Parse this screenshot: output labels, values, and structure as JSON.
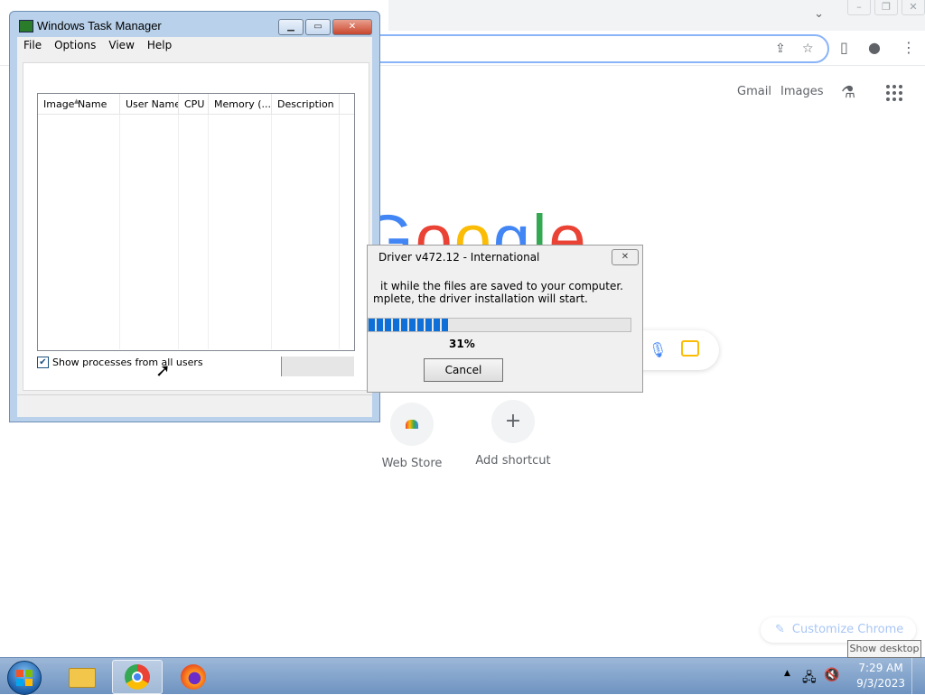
{
  "browser": {
    "window_buttons": [
      "–",
      "❐",
      "✕"
    ],
    "top_links": {
      "gmail": "Gmail",
      "images": "Images"
    },
    "logo_letters": [
      "G",
      "o",
      "o",
      "g",
      "l",
      "e"
    ],
    "shortcuts": [
      {
        "label": "Web Store",
        "icon": "webstore-icon"
      },
      {
        "label": "Add shortcut",
        "icon": "+"
      }
    ],
    "customize_label": "Customize Chrome",
    "show_desktop_tooltip": "Show desktop"
  },
  "task_manager": {
    "title": "Windows Task Manager",
    "menu": [
      "File",
      "Options",
      "View",
      "Help"
    ],
    "columns": [
      "Image Name",
      "User Name",
      "CPU",
      "Memory (...",
      "Description"
    ],
    "show_all_users_label": "Show processes from all users",
    "show_all_users_checked": true
  },
  "driver_dialog": {
    "title": "Driver v472.12 - International",
    "message_line1": "it while the files are saved to your computer.",
    "message_line2": "mplete, the driver installation will start.",
    "progress_percent": 31,
    "progress_label": "31%",
    "cancel_label": "Cancel"
  },
  "taskbar": {
    "apps": [
      "explorer-icon",
      "chrome-icon",
      "firefox-icon"
    ],
    "active_app": "chrome-icon",
    "time": "7:29 AM",
    "date": "9/3/2023"
  }
}
